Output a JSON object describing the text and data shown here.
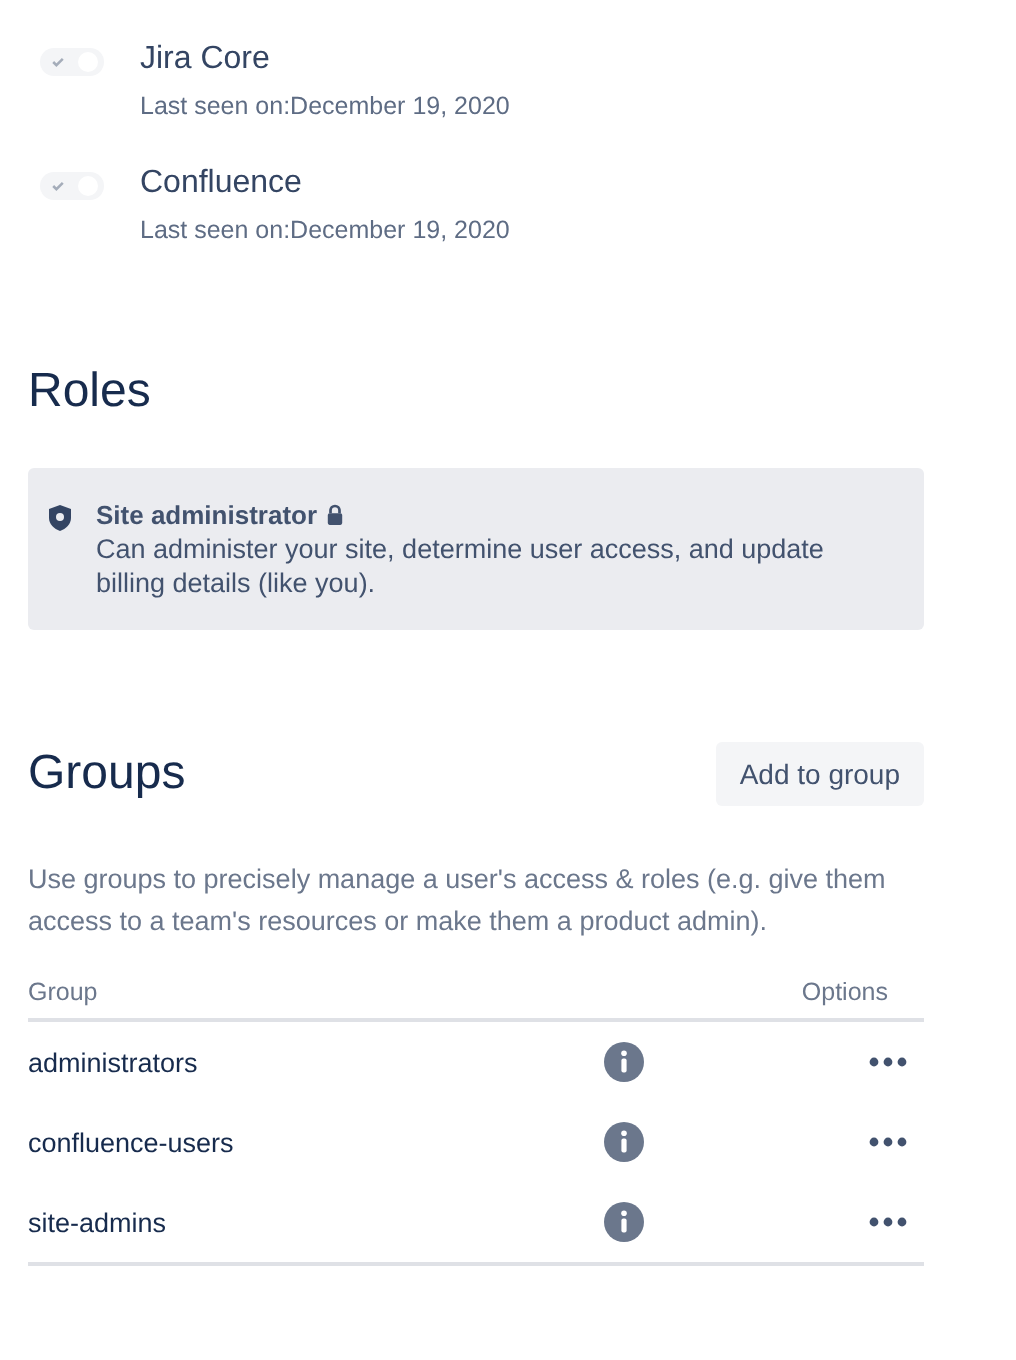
{
  "products": [
    {
      "name": "Jira Core",
      "last_seen": "Last seen on:December 19, 2020",
      "checked": true,
      "disabled": true
    },
    {
      "name": "Confluence",
      "last_seen": "Last seen on:December 19, 2020",
      "checked": true,
      "disabled": true
    }
  ],
  "roles": {
    "title": "Roles",
    "items": [
      {
        "name": "Site administrator",
        "locked": true,
        "description": "Can administer your site, determine user access, and update billing details (like you)."
      }
    ]
  },
  "groups": {
    "title": "Groups",
    "add_button": "Add to group",
    "description": "Use groups to precisely manage a user's access & roles (e.g. give them access to a team's resources or make them a product admin).",
    "columns": [
      "Group",
      "Options"
    ],
    "rows": [
      {
        "name": "administrators"
      },
      {
        "name": "confluence-users"
      },
      {
        "name": "site-admins"
      }
    ]
  }
}
